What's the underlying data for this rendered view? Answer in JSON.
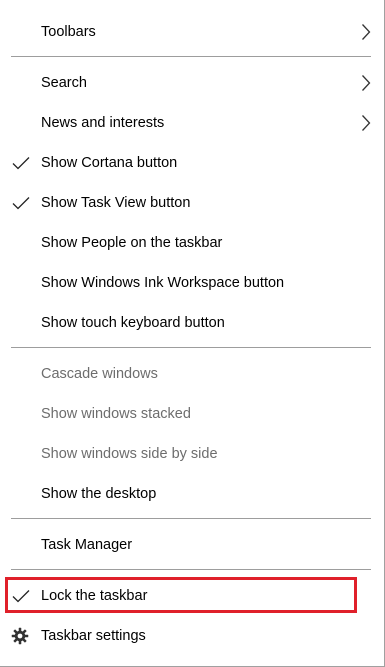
{
  "menu": {
    "toolbars": "Toolbars",
    "search": "Search",
    "news": "News and interests",
    "cortana": "Show Cortana button",
    "taskview": "Show Task View button",
    "people": "Show People on the taskbar",
    "ink": "Show Windows Ink Workspace button",
    "touch": "Show touch keyboard button",
    "cascade": "Cascade windows",
    "stacked": "Show windows stacked",
    "sidebyside": "Show windows side by side",
    "desktop": "Show the desktop",
    "taskmanager": "Task Manager",
    "lock": "Lock the taskbar",
    "settings": "Taskbar settings"
  },
  "state": {
    "cortana_checked": true,
    "taskview_checked": true,
    "lock_checked": true,
    "disabled_items": [
      "Cascade windows",
      "Show windows stacked",
      "Show windows side by side"
    ],
    "highlighted_item": "Lock the taskbar"
  },
  "colors": {
    "highlight_border": "#e0202a",
    "disabled_text": "#6d6d6d",
    "separator": "#9d9d9d"
  },
  "icons": {
    "check": "checkmark-icon",
    "submenu": "chevron-right-icon",
    "settings": "gear-icon"
  }
}
